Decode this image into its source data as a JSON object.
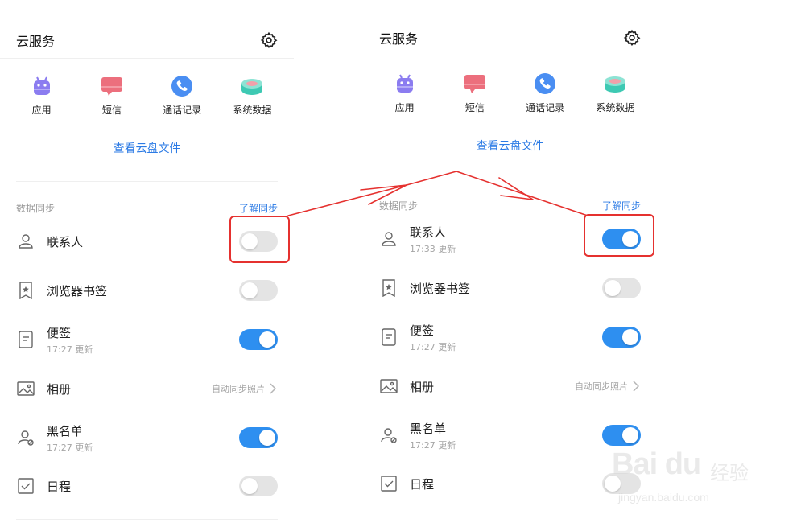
{
  "panels": [
    {
      "title": "云服务",
      "categories": [
        {
          "label": "应用",
          "icon": "android-icon"
        },
        {
          "label": "短信",
          "icon": "message-icon"
        },
        {
          "label": "通话记录",
          "icon": "phone-icon"
        },
        {
          "label": "系统数据",
          "icon": "database-icon"
        }
      ],
      "view_cloud_files": "查看云盘文件",
      "sync_section_title": "数据同步",
      "learn_sync": "了解同步",
      "rows": [
        {
          "label": "联系人",
          "sub": "",
          "toggle": "off",
          "icon": "contact-icon"
        },
        {
          "label": "浏览器书签",
          "sub": "",
          "toggle": "off",
          "icon": "bookmark-icon"
        },
        {
          "label": "便签",
          "sub": "17:27 更新",
          "toggle": "on",
          "icon": "note-icon"
        },
        {
          "label": "相册",
          "sub": "",
          "right_text": "自动同步照片",
          "icon": "photo-icon"
        },
        {
          "label": "黑名单",
          "sub": "17:27 更新",
          "toggle": "on",
          "icon": "blacklist-icon"
        },
        {
          "label": "日程",
          "sub": "",
          "toggle": "off",
          "icon": "calendar-icon"
        }
      ]
    },
    {
      "title": "云服务",
      "categories": [
        {
          "label": "应用",
          "icon": "android-icon"
        },
        {
          "label": "短信",
          "icon": "message-icon"
        },
        {
          "label": "通话记录",
          "icon": "phone-icon"
        },
        {
          "label": "系统数据",
          "icon": "database-icon"
        }
      ],
      "view_cloud_files": "查看云盘文件",
      "sync_section_title": "数据同步",
      "learn_sync": "了解同步",
      "rows": [
        {
          "label": "联系人",
          "sub": "17:33 更新",
          "toggle": "on",
          "icon": "contact-icon"
        },
        {
          "label": "浏览器书签",
          "sub": "",
          "toggle": "off",
          "icon": "bookmark-icon"
        },
        {
          "label": "便签",
          "sub": "17:27 更新",
          "toggle": "on",
          "icon": "note-icon"
        },
        {
          "label": "相册",
          "sub": "",
          "right_text": "自动同步照片",
          "icon": "photo-icon"
        },
        {
          "label": "黑名单",
          "sub": "17:27 更新",
          "toggle": "on",
          "icon": "blacklist-icon"
        },
        {
          "label": "日程",
          "sub": "",
          "toggle": "off",
          "icon": "calendar-icon"
        }
      ]
    }
  ],
  "watermark": {
    "logo": "Bai du",
    "brand_cn": "经验",
    "url": "jingyan.baidu.com"
  },
  "colors": {
    "accent": "#2e8ff0",
    "link": "#2c7be5",
    "annotation": "#e5312f",
    "toggle_off": "#e4e4e4"
  }
}
